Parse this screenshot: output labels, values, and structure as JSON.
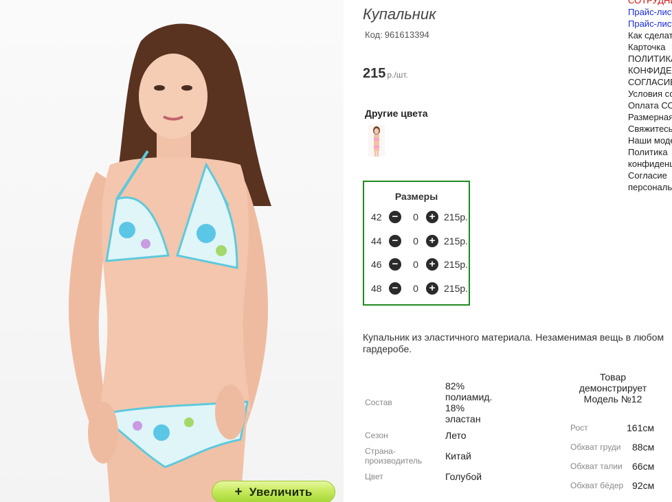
{
  "product": {
    "title": "Купальник",
    "code_label": "Код:",
    "code": "961613394",
    "price": "215",
    "price_unit": "р./шт.",
    "zoom_label": "Увеличить",
    "zoom_symbol": "+"
  },
  "other_colors": {
    "heading": "Другие цвета"
  },
  "sizes": {
    "heading": "Размеры",
    "rows": [
      {
        "size": "42",
        "qty": "0",
        "price": "215р."
      },
      {
        "size": "44",
        "qty": "0",
        "price": "215р."
      },
      {
        "size": "46",
        "qty": "0",
        "price": "215р."
      },
      {
        "size": "48",
        "qty": "0",
        "price": "215р."
      }
    ],
    "minus_symbol": "−",
    "plus_symbol": "+",
    "border_color": "#1f8a1f"
  },
  "description": "Купальник из эластичного материала. Незаменимая вещь в любом гардеробе.",
  "specs": {
    "composition_label": "Состав",
    "composition_value": "82% полиамид. 18% эластан",
    "season_label": "Сезон",
    "season_value": "Лето",
    "country_label": "Страна-производитель",
    "country_value": "Китай",
    "color_label": "Цвет",
    "color_value": "Голубой"
  },
  "model": {
    "heading": "Товар демонстрирует Модель №12",
    "rows": [
      {
        "label": "Рост",
        "value": "161см"
      },
      {
        "label": "Обхват груди",
        "value": "88см"
      },
      {
        "label": "Обхват талии",
        "value": "66см"
      },
      {
        "label": "Обхват бёдер",
        "value": "92см"
      }
    ]
  },
  "side_links": [
    {
      "text": "СОТРУДНИЧЕСТВО",
      "color": "red"
    },
    {
      "text": "Прайс-лист",
      "color": "blue"
    },
    {
      "text": "Прайс-лист",
      "color": "blue"
    },
    {
      "text": "Как сделать заказ",
      "color": "default"
    },
    {
      "text": "Карточка",
      "color": "default"
    },
    {
      "text": "ПОЛИТИКА",
      "color": "default"
    },
    {
      "text": "КОНФИДЕНЦИАЛЬНОСТИ",
      "color": "default"
    },
    {
      "text": "СОГЛАСИЕ",
      "color": "default"
    },
    {
      "text": "Условия сотрудничества",
      "color": "default"
    },
    {
      "text": "Оплата СОД",
      "color": "default"
    },
    {
      "text": "Размерная сетка",
      "color": "default"
    },
    {
      "text": "Свяжитесь с нами",
      "color": "default"
    },
    {
      "text": "Наши модели",
      "color": "default"
    },
    {
      "text": "Политика",
      "color": "default"
    },
    {
      "text": "конфиденциальности",
      "color": "default"
    },
    {
      "text": "Согласие",
      "color": "default"
    },
    {
      "text": "персональных",
      "color": "default"
    }
  ]
}
